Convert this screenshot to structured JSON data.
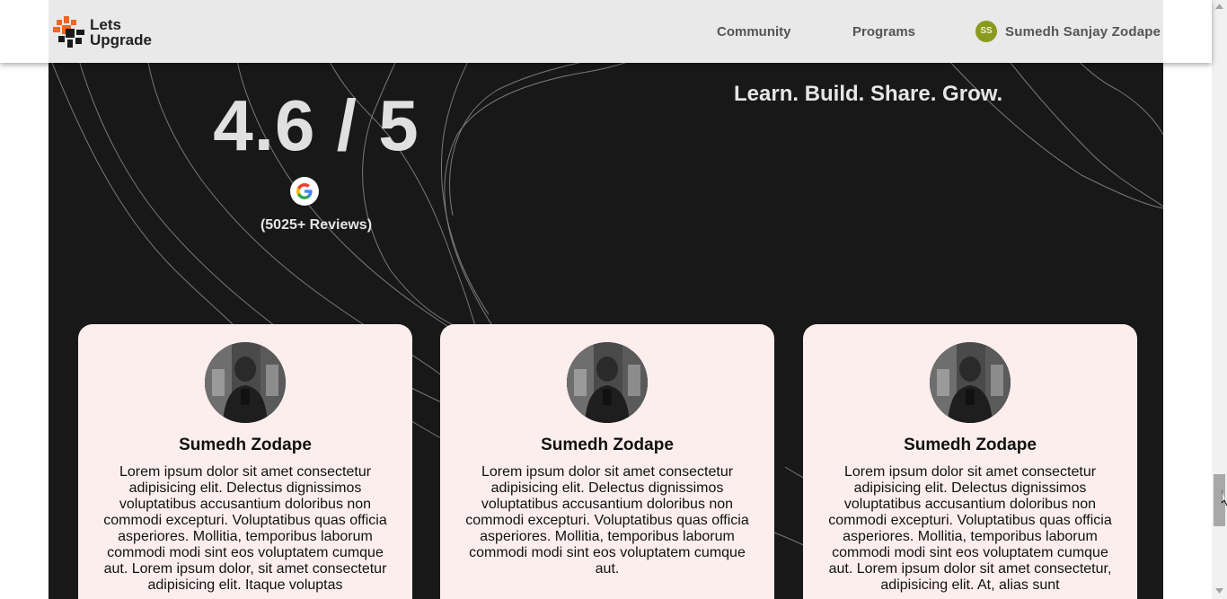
{
  "navbar": {
    "logo_line1": "Lets",
    "logo_line2": "Upgrade",
    "links": [
      "Community",
      "Programs"
    ],
    "user_initials": "SS",
    "user_name": "Sumedh Sanjay Zodape"
  },
  "hero": {
    "rating": "4.6 / 5",
    "reviews": "(5025+ Reviews)",
    "tagline": "Learn. Build. Share. Grow."
  },
  "cards": [
    {
      "name": "Sumedh Zodape",
      "text": "Lorem ipsum dolor sit amet consectetur adipisicing elit. Delectus dignissimos voluptatibus accusantium doloribus non commodi excepturi. Voluptatibus quas officia asperiores. Mollitia, temporibus laborum commodi modi sint eos voluptatem cumque aut. Lorem ipsum dolor, sit amet consectetur adipisicing elit. Itaque voluptas"
    },
    {
      "name": "Sumedh Zodape",
      "text": "Lorem ipsum dolor sit amet consectetur adipisicing elit. Delectus dignissimos voluptatibus accusantium doloribus non commodi excepturi. Voluptatibus quas officia asperiores. Mollitia, temporibus laborum commodi modi sint eos voluptatem cumque aut."
    },
    {
      "name": "Sumedh Zodape",
      "text": "Lorem ipsum dolor sit amet consectetur adipisicing elit. Delectus dignissimos voluptatibus accusantium doloribus non commodi excepturi. Voluptatibus quas officia asperiores. Mollitia, temporibus laborum commodi modi sint eos voluptatem cumque aut. Lorem ipsum dolor sit amet consectetur, adipisicing elit. At, alias sunt"
    }
  ],
  "colors": {
    "background": "#181818",
    "card": "#fdeeee",
    "brand_orange": "#f26522",
    "avatar_badge": "#8a9a1e"
  },
  "icons": [
    "google-icon",
    "scroll-up-arrow-icon",
    "scroll-down-arrow-icon",
    "mouse-cursor-icon"
  ]
}
